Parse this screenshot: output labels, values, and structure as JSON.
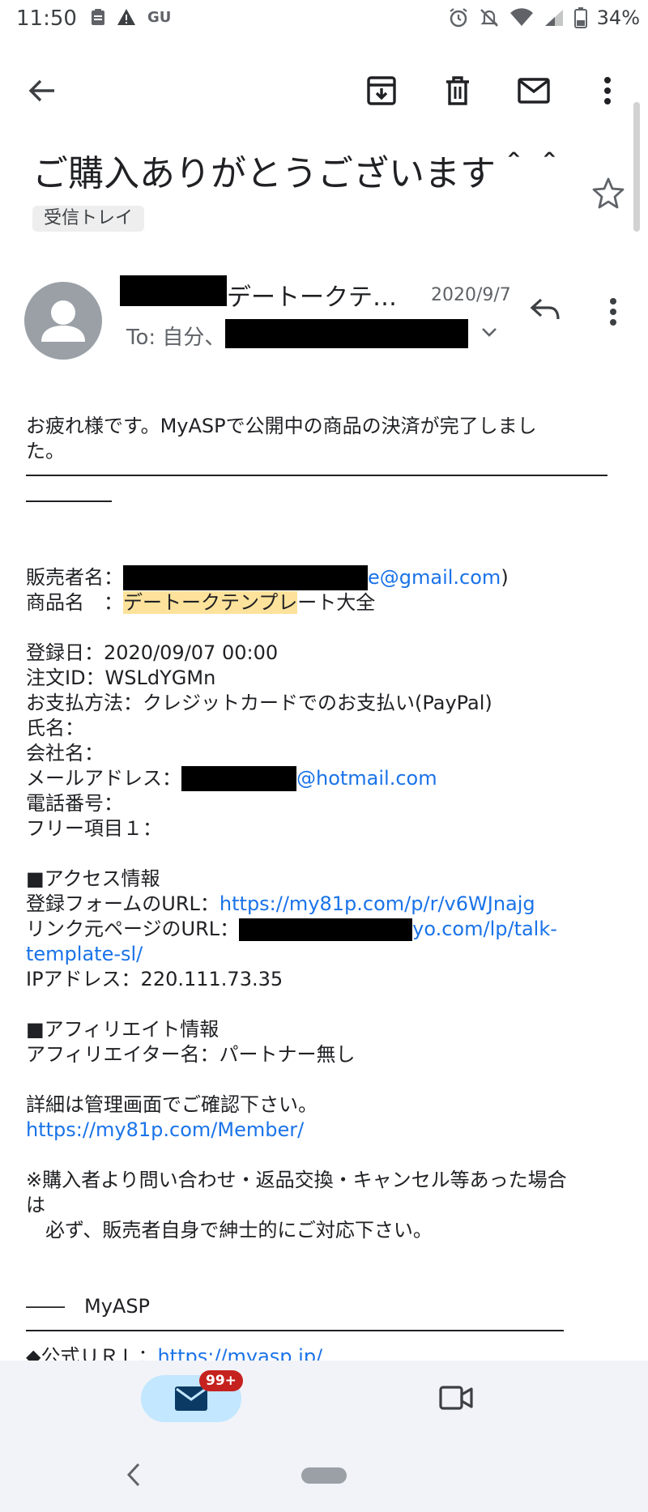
{
  "status": {
    "time": "11:50",
    "carrier": "GU",
    "battery": "34%"
  },
  "icons": {
    "back": "arrow-left-icon",
    "archive": "archive-icon",
    "delete": "trash-icon",
    "mark_unread": "mail-icon",
    "more": "more-vert-icon",
    "star": "star-icon",
    "reply": "reply-icon",
    "expand": "chevron-down-icon",
    "meet": "video-icon"
  },
  "email": {
    "subject": "ご購入ありがとうございます＾＾",
    "label": "受信トレイ",
    "sender_name": "デートークテ…",
    "date": "2020/9/7",
    "to_prefix": "To: 自分、"
  },
  "body": {
    "greeting1": "お疲れ様です。MyASPで公開中の商品の決済が完了しまし",
    "greeting2": "た。",
    "seller_label": "販売者名：",
    "seller_email_tail": "e@gmail.com",
    "seller_close": ")",
    "product_label": "商品名　：",
    "product_hl": "デートークテンプレ",
    "product_rest": "ート大全",
    "reg_date": "登録日：2020/09/07 00:00",
    "order_id": "注文ID：WSLdYGMn",
    "payment": "お支払方法：クレジットカードでのお支払い(PayPal)",
    "name": "氏名：",
    "company": "会社名：",
    "mail_label": "メールアドレス：",
    "mail_tail": "@hotmail.com",
    "phone": "電話番号：",
    "free_item": "フリー項目１：",
    "access_header": "■アクセス情報",
    "form_url_label": "登録フォームのURL：",
    "form_url": "https://my81p.com/p/r/v6WJnajg",
    "link_page_label": "リンク元ページのURL：",
    "link_page_tail": "yo.com/lp/talk-",
    "link_page_line2": "template-sl/",
    "ip": "IPアドレス：220.111.73.35",
    "affiliate_header": "■アフィリエイト情報",
    "affiliate_name": "アフィリエイター名：パートナー無し",
    "details": "詳細は管理画面でご確認下さい。",
    "member_url": "https://my81p.com/Member/",
    "note1": "※購入者より問い合わせ・返品交換・キャンセル等あった場合",
    "note2": "は",
    "note3": "　必ず、販売者自身で紳士的にご対応下さい。",
    "footer_brand": "――　MyASP",
    "official_label": "◆公式ＵＲＬ：",
    "official_url": "https://myasp.jp/"
  },
  "nav": {
    "badge": "99+"
  }
}
